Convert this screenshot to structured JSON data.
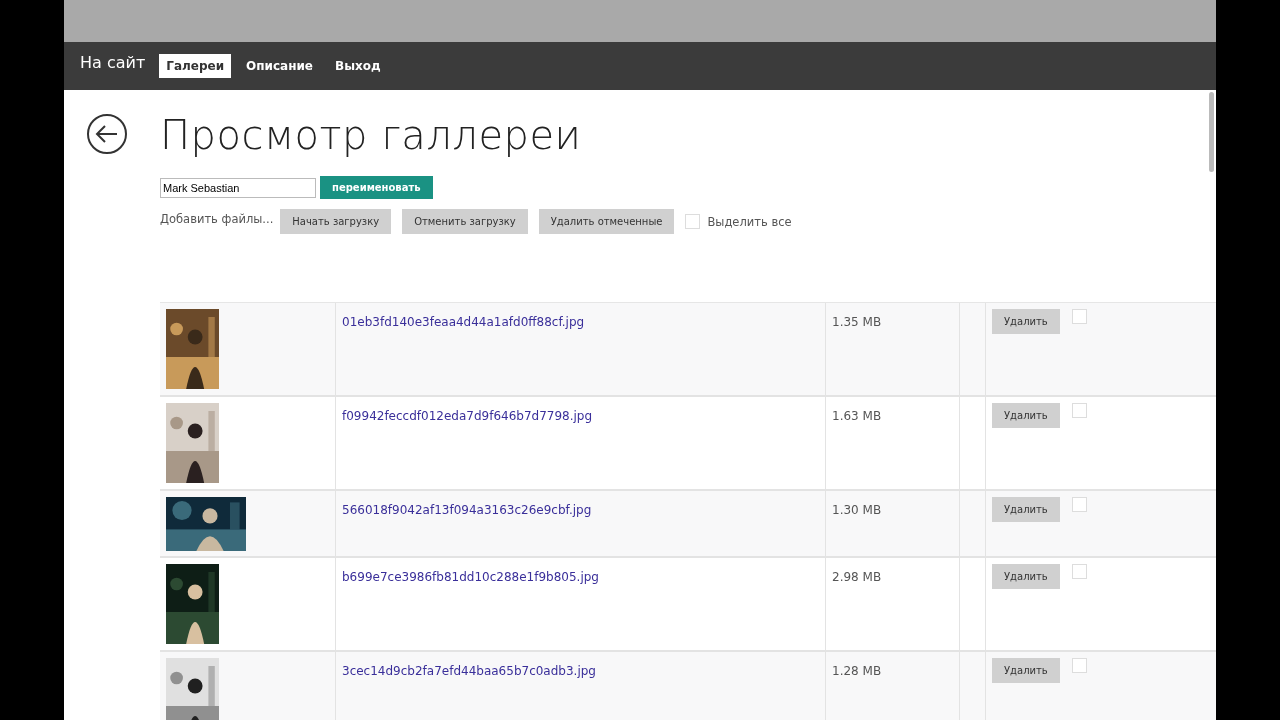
{
  "nav": {
    "brand": "На сайт",
    "tabs": [
      {
        "label": "Галереи",
        "selected": true
      },
      {
        "label": "Описание",
        "selected": false
      },
      {
        "label": "Выход",
        "selected": false
      }
    ]
  },
  "page": {
    "title": "Просмотр галлереи"
  },
  "rename": {
    "value": "Mark Sebastian",
    "button": "переименовать"
  },
  "toolbar": {
    "add_files": "Добавить файлы...",
    "buttons": [
      "Начать загрузку",
      "Отменить загрузку",
      "Удалить отмеченные"
    ],
    "select_all": {
      "label": "Выделить все",
      "checked": false
    }
  },
  "files": [
    {
      "thumb": {
        "kind": "portrait"
      },
      "name": "01eb3fd140e3feaa4d44a1afd0ff88cf.jpg",
      "size": "1.35 MB",
      "delete": "Удалить",
      "checked": false
    },
    {
      "thumb": {
        "kind": "portrait"
      },
      "name": "f09942feccdf012eda7d9f646b7d7798.jpg",
      "size": "1.63 MB",
      "delete": "Удалить",
      "checked": false
    },
    {
      "thumb": {
        "kind": "landscape"
      },
      "name": "566018f9042af13f094a3163c26e9cbf.jpg",
      "size": "1.30 MB",
      "delete": "Удалить",
      "checked": false
    },
    {
      "thumb": {
        "kind": "portrait"
      },
      "name": "b699e7ce3986fb81dd10c288e1f9b805.jpg",
      "size": "2.98 MB",
      "delete": "Удалить",
      "checked": false
    },
    {
      "thumb": {
        "kind": "portrait"
      },
      "name": "3cec14d9cb2fa7efd44baa65b7c0adb3.jpg",
      "size": "1.28 MB",
      "delete": "Удалить",
      "checked": false
    }
  ]
}
